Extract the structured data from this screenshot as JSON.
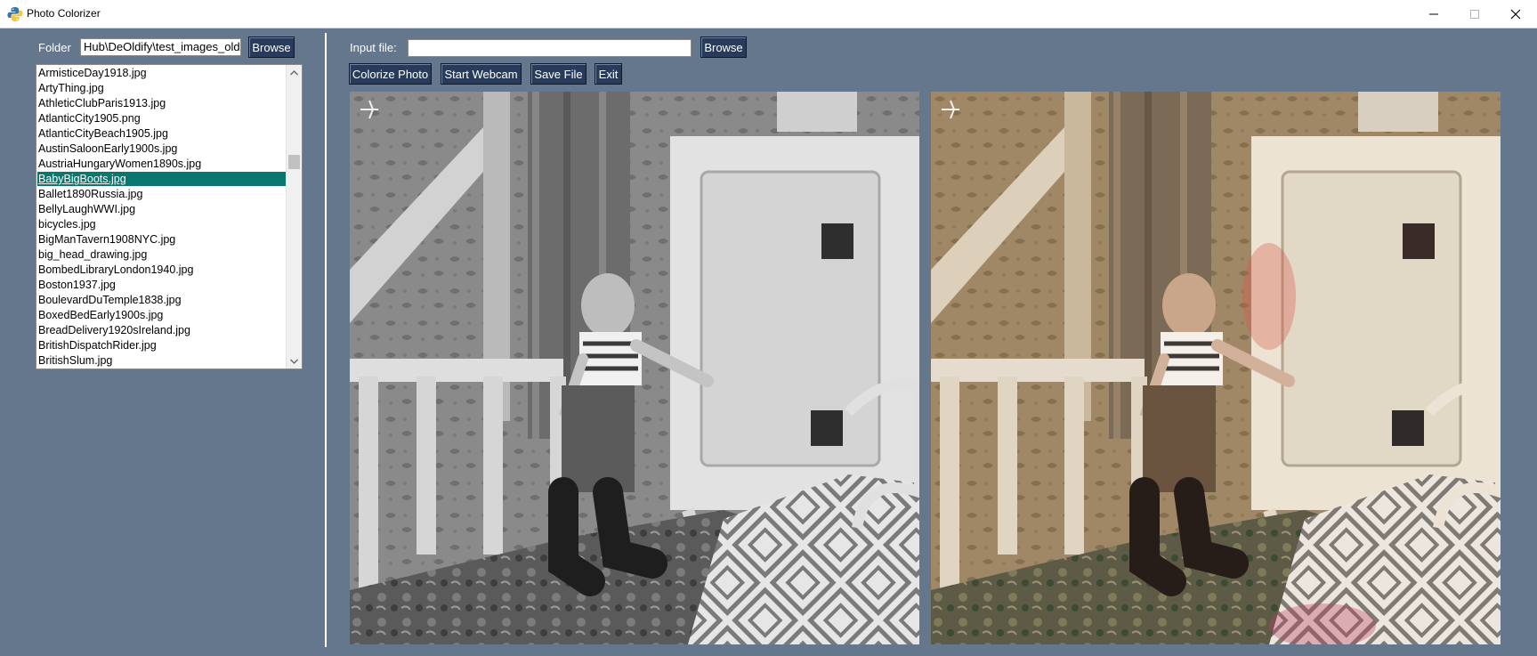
{
  "window": {
    "title": "Photo Colorizer"
  },
  "folder": {
    "label": "Folder",
    "value": "Hub\\DeOldify\\test_images_old",
    "browse_label": "Browse"
  },
  "input": {
    "label": "Input file:",
    "value": "",
    "browse_label": "Browse"
  },
  "actions": {
    "colorize": "Colorize Photo",
    "webcam": "Start Webcam",
    "save": "Save File",
    "exit": "Exit"
  },
  "files": [
    "ArmisticeDay1918.jpg",
    "ArtyThing.jpg",
    "AthleticClubParis1913.jpg",
    "AtlanticCity1905.png",
    "AtlanticCityBeach1905.jpg",
    "AustinSaloonEarly1900s.jpg",
    "AustriaHungaryWomen1890s.jpg",
    "BabyBigBoots.jpg",
    "Ballet1890Russia.jpg",
    "BellyLaughWWI.jpg",
    "bicycles.jpg",
    "BigManTavern1908NYC.jpg",
    "big_head_drawing.jpg",
    "BombedLibraryLondon1940.jpg",
    "Boston1937.jpg",
    "BoulevardDuTemple1838.jpg",
    "BoxedBedEarly1900s.jpg",
    "BreadDelivery1920sIreland.jpg",
    "BritishDispatchRider.jpg",
    "BritishSlum.jpg"
  ],
  "selected_file": "BabyBigBoots.jpg",
  "colors": {
    "background": "#64778d",
    "button": "#283b5b",
    "selection": "#09776f"
  }
}
